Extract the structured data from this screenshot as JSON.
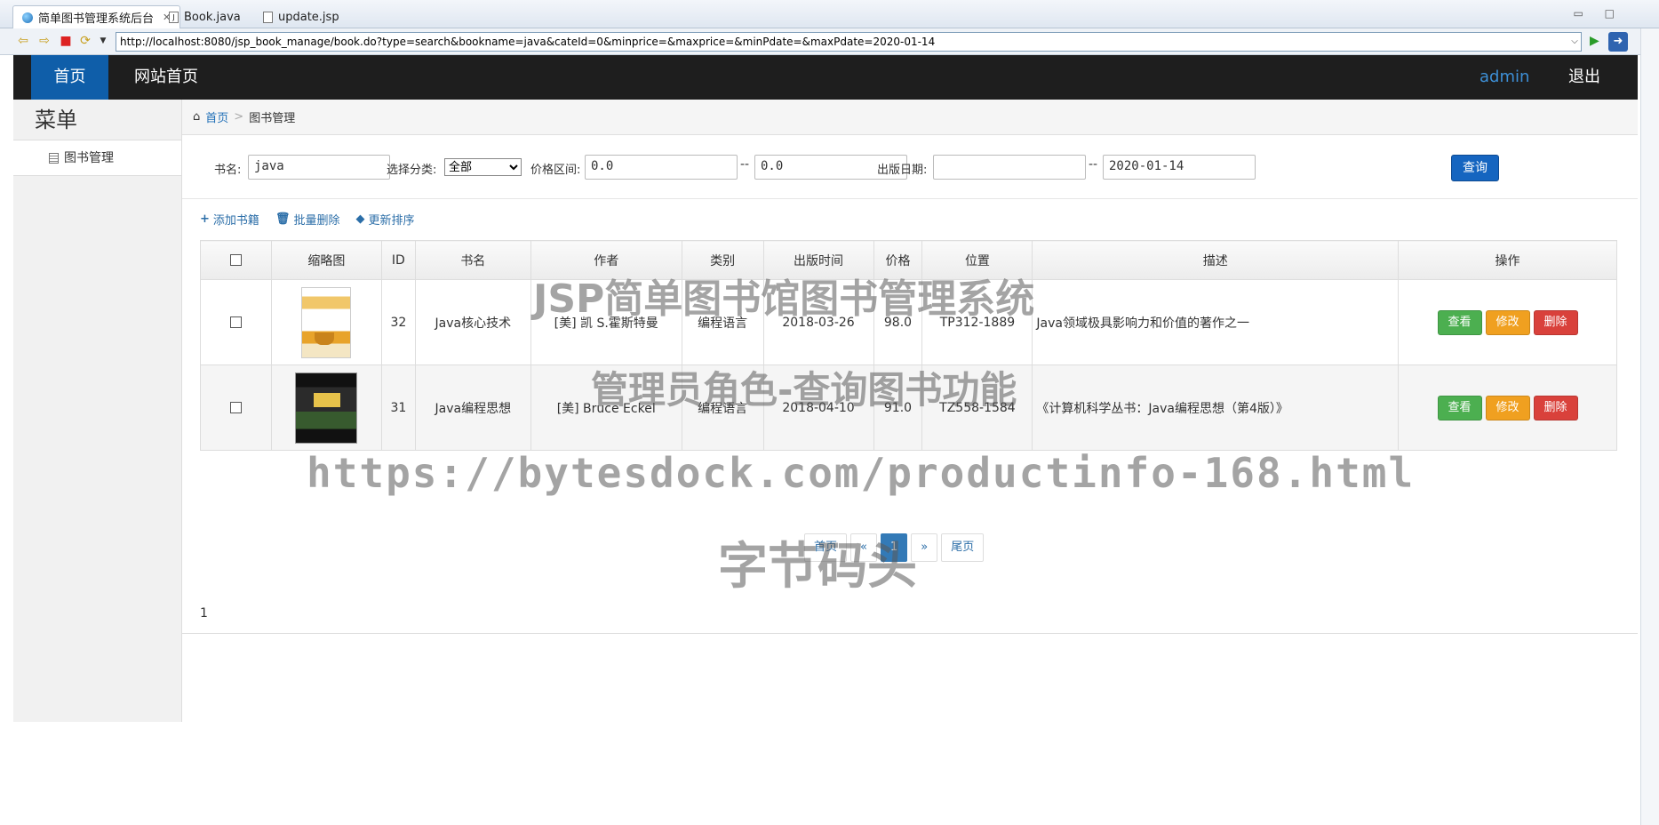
{
  "ide": {
    "tabs": [
      {
        "label": "简单图书管理系统后台",
        "active": true
      },
      {
        "label": "Book.java",
        "active": false
      },
      {
        "label": "update.jsp",
        "active": false
      }
    ],
    "url": "http://localhost:8080/jsp_book_manage/book.do?type=search&bookname=java&cateId=0&minprice=&maxprice=&minPdate=&maxPdate=2020-01-14"
  },
  "topnav": {
    "home": "首页",
    "site": "网站首页",
    "user": "admin",
    "logout": "退出"
  },
  "sidebar": {
    "title": "菜单",
    "items": [
      {
        "label": "图书管理"
      }
    ]
  },
  "breadcrumb": {
    "home": "首页",
    "current": "图书管理"
  },
  "search": {
    "bookname_label": "书名:",
    "bookname_value": "java",
    "category_label": "选择分类:",
    "category_selected": "全部",
    "price_label": "价格区间:",
    "min_price": "0.0",
    "max_price": "0.0",
    "date_label": "出版日期:",
    "min_date": "",
    "max_date": "2020-01-14",
    "range_sep": "--",
    "submit": "查询"
  },
  "toolbar": {
    "add": "添加书籍",
    "batch_delete": "批量删除",
    "update_sort": "更新排序"
  },
  "table": {
    "headers": [
      "缩略图",
      "ID",
      "书名",
      "作者",
      "类别",
      "出版时间",
      "价格",
      "位置",
      "描述",
      "操作"
    ],
    "rows": [
      {
        "id": "32",
        "name": "Java核心技术",
        "author": "[美] 凯 S.霍斯特曼",
        "category": "编程语言",
        "date": "2018-03-26",
        "price": "98.0",
        "location": "TP312-1889",
        "desc": "Java领域极具影响力和价值的著作之一"
      },
      {
        "id": "31",
        "name": "Java编程思想",
        "author": "[美] Bruce Eckel",
        "category": "编程语言",
        "date": "2018-04-10",
        "price": "91.0",
        "location": "TZ558-1584",
        "desc": "《计算机科学丛书：Java编程思想（第4版）》"
      }
    ],
    "actions": {
      "view": "查看",
      "edit": "修改",
      "delete": "删除"
    }
  },
  "pager": {
    "first": "首页",
    "prev": "«",
    "current": "1",
    "next": "»",
    "last": "尾页"
  },
  "count": "1",
  "watermarks": [
    "JSP简单图书馆图书管理系统",
    "管理员角色-查询图书功能",
    "https://bytesdock.com/productinfo-168.html",
    "字节码头"
  ]
}
